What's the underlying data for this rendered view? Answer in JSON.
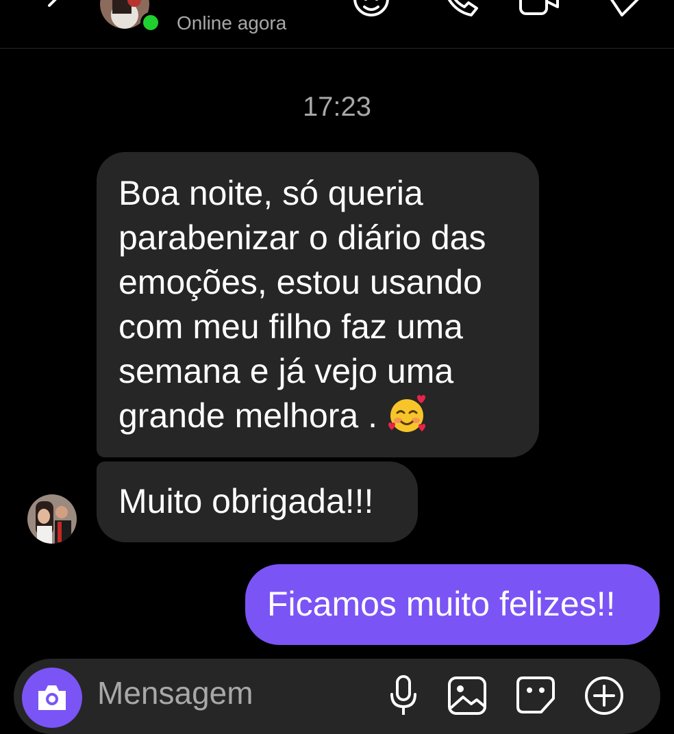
{
  "header": {
    "status": "Online agora"
  },
  "conversation": {
    "timestamp": "17:23",
    "incoming": [
      {
        "text": "Boa noite, só queria\nparabenizar o diário das\nemoções, estou usando\ncom meu filho faz uma\nsemana e já vejo uma\ngrande melhora .",
        "emoji": "smiling-face-with-hearts"
      },
      {
        "text": "Muito obrigada!!!"
      }
    ],
    "outgoing": [
      {
        "text": "Ficamos muito felizes!!"
      }
    ]
  },
  "composer": {
    "placeholder": "Mensagem"
  },
  "colors": {
    "background": "#000000",
    "incoming_bubble": "#262626",
    "outgoing_bubble": "#7b54f5",
    "online": "#1fd12e",
    "muted_text": "#a8a8a8"
  }
}
